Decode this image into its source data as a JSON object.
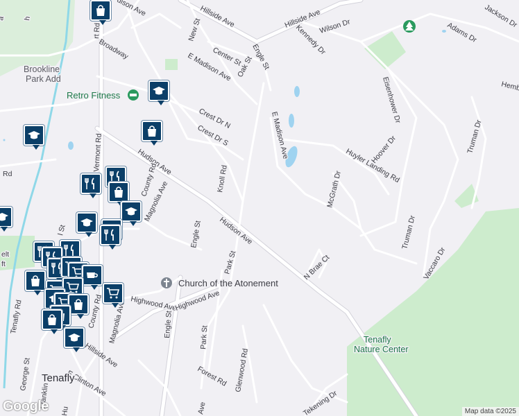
{
  "colors": {
    "background": "#f1f0f4",
    "road": "#ffffff",
    "road_edge": "#d6d5dc",
    "park": "#cdeccd",
    "water": "#9fd3f0",
    "pin": "#0b3f68",
    "railway": "#8fd8e8"
  },
  "map": {
    "streets": {
      "hillside_ave_1": "Hillside Ave",
      "hillside_ave_2": "Hillside Ave",
      "wilson_dr": "Wilson Dr",
      "kennedy_dr": "Kennedy Dr",
      "jackson_dr": "Jackson Dr",
      "adams_dr": "Adams Dr",
      "hamb": "Hemb",
      "madison_ave_top": "dison Ave",
      "new_st": "New St",
      "center_st": "Center St",
      "oak_st": "Oak St",
      "engle_st_top": "Engle St",
      "e_madison_ave_1": "E Madison Ave",
      "e_madison_ave_2": "E Madison Ave",
      "broadway": "Broadway",
      "crest_dr_n": "Crest Dr N",
      "crest_dr_s": "Crest Dr S",
      "knoll_rd": "Knoll Rd",
      "eisenhower_dr": "Eisenhower Dr",
      "hoover_dr": "Hoover Dr",
      "truman_dr_1": "Truman Dr",
      "truman_dr_2": "Truman Dr",
      "huyler_landing_rd": "Huyler Landing Rd",
      "mcgrath_dr": "McGrath Dr",
      "vaccaro_dr": "Vaccaro Dr",
      "hudson_ave_1": "Hudson Ave",
      "hudson_ave_2": "Hudson Ave",
      "vermont_rd": "Vermont Rd",
      "county_rd_1": "County Rd",
      "county_rd_2": "County Rd",
      "magnolia_ave_1": "Magnolia Ave",
      "magnolia_ave_2": "Magnolia Ave",
      "engle_st_mid": "Engle St",
      "engle_st_low": "Engle St",
      "park_st_1": "Park St",
      "park_st_2": "Park St",
      "n_brae_ct": "N Brae Ct",
      "highwood_ave_1": "Highwood Ave",
      "highwood_ave_2": "Highwood Ave",
      "glenwood_rd": "Glenwood Rd",
      "forest_rd": "Forest Rd",
      "tekening_dr": "Tekening Dr",
      "e_clinton_ave": "E Clinton Ave",
      "hillside_ave_low": "Hillside Ave",
      "george_st": "George St",
      "franklin_st": "Franklin St",
      "tenafly_rd": "Tenafly Rd",
      "ave_bottom": "Ave",
      "hu_bottom": "Hu",
      "l_st": "l St",
      "rd_left": "Rd",
      "rt_rd": "rt Rd",
      "gelt_a": "elt",
      "gelt_b": "ft",
      "h_a": "a",
      "h_b": "h"
    },
    "places": {
      "brookline": "Brookline",
      "park_add": "Park Add",
      "tenafly": "Tenafly",
      "nature_center_1": "Tenafly",
      "nature_center_2": "Nature Center"
    },
    "pois": {
      "retro_fitness": "Retro Fitness",
      "church": "Church of the Atonement"
    },
    "icons": [
      "shopping-bag-icon",
      "graduation-cap-icon",
      "restaurant-icon",
      "shopping-cart-icon",
      "coffee-icon",
      "tree-icon",
      "church-icon",
      "fitness-icon"
    ],
    "footer": {
      "logo": "Google",
      "attribution": "Map data ©2025"
    }
  }
}
